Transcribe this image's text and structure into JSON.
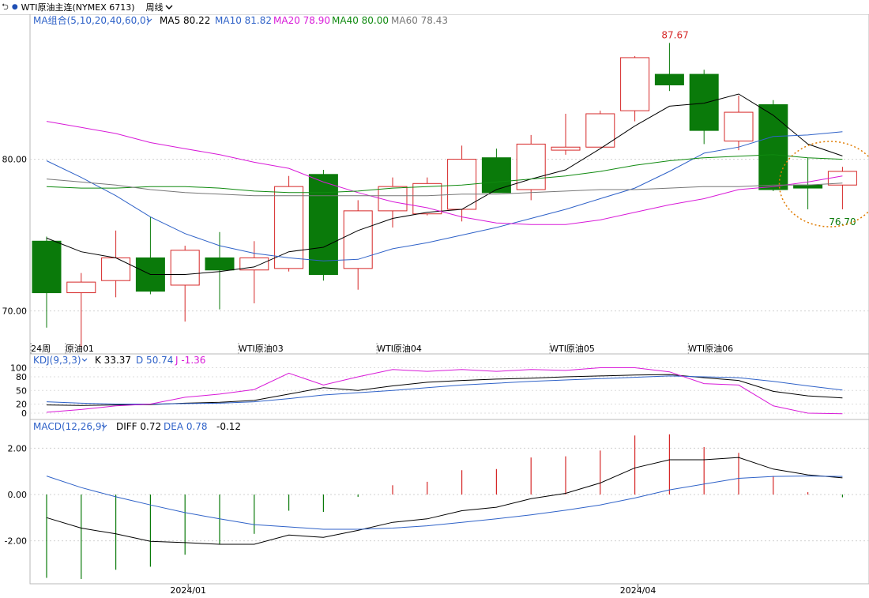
{
  "header": {
    "instrument": "WTI原油主连(NYMEX 6713)",
    "period": "周线"
  },
  "colors": {
    "up": "#d62828",
    "down": "#0a7a0a",
    "ma5": "#000000",
    "ma10": "#2f62c8",
    "ma20": "#d81ad8",
    "ma40": "#108a10",
    "ma60": "#777777",
    "dif": "#000000",
    "dea": "#2f62c8",
    "annotation": "#e07b00"
  },
  "legends": {
    "ma": {
      "name": "MA组合(5,10,20,40,60,0)",
      "ma5": "MA5 80.22",
      "ma10": "MA10 81.82",
      "ma20": "MA20 78.90",
      "ma40": "MA40 80.00",
      "ma60": "MA60 78.43"
    },
    "kdj": {
      "name": "KDJ(9,3,3)",
      "k": "K 33.37",
      "d": "D 50.74",
      "j": "J -1.36"
    },
    "macd": {
      "name": "MACD(12,26,9)",
      "diff": "DIFF 0.72",
      "dea": "DEA 0.78",
      "macd": "-0.12"
    }
  },
  "chart_data": [
    {
      "type": "candlestick",
      "title": "WTI原油主连(NYMEX 6713) 周线",
      "ylim": [
        67,
        88.7
      ],
      "yticks": [
        70,
        80
      ],
      "ytick_labels": [
        "70.00",
        "80.00"
      ],
      "x_labels": [
        {
          "index": 0,
          "text": "24周"
        },
        {
          "index": 1,
          "text": "原油01"
        },
        {
          "index": 6,
          "text": "WTI原油03"
        },
        {
          "index": 10,
          "text": "WTI原油04"
        },
        {
          "index": 15,
          "text": "WTI原油05"
        },
        {
          "index": 19,
          "text": "WTI原油06"
        }
      ],
      "candles": [
        {
          "o": 74.6,
          "h": 74.9,
          "l": 68.9,
          "c": 71.2
        },
        {
          "o": 71.2,
          "h": 72.5,
          "l": 67.6,
          "c": 71.9
        },
        {
          "o": 72.0,
          "h": 75.3,
          "l": 70.9,
          "c": 73.5
        },
        {
          "o": 73.5,
          "h": 76.2,
          "l": 71.1,
          "c": 71.3
        },
        {
          "o": 71.7,
          "h": 74.3,
          "l": 69.3,
          "c": 74.0
        },
        {
          "o": 73.5,
          "h": 75.2,
          "l": 70.1,
          "c": 72.7
        },
        {
          "o": 72.7,
          "h": 74.6,
          "l": 70.5,
          "c": 73.5
        },
        {
          "o": 72.8,
          "h": 78.9,
          "l": 72.6,
          "c": 78.2
        },
        {
          "o": 79.0,
          "h": 79.3,
          "l": 72.0,
          "c": 72.4
        },
        {
          "o": 72.8,
          "h": 77.3,
          "l": 71.4,
          "c": 76.6
        },
        {
          "o": 76.6,
          "h": 78.8,
          "l": 75.5,
          "c": 78.2
        },
        {
          "o": 76.4,
          "h": 78.8,
          "l": 76.3,
          "c": 78.4
        },
        {
          "o": 76.7,
          "h": 80.9,
          "l": 75.9,
          "c": 80.0
        },
        {
          "o": 80.1,
          "h": 80.7,
          "l": 77.9,
          "c": 77.8
        },
        {
          "o": 78.0,
          "h": 81.6,
          "l": 77.3,
          "c": 81.0
        },
        {
          "o": 80.6,
          "h": 83.0,
          "l": 80.3,
          "c": 80.8
        },
        {
          "o": 80.8,
          "h": 83.2,
          "l": 80.9,
          "c": 83.0
        },
        {
          "o": 83.2,
          "h": 86.8,
          "l": 82.5,
          "c": 86.7
        },
        {
          "o": 85.6,
          "h": 87.67,
          "l": 84.5,
          "c": 84.9
        },
        {
          "o": 85.6,
          "h": 85.9,
          "l": 81.0,
          "c": 81.9
        },
        {
          "o": 81.2,
          "h": 84.2,
          "l": 80.6,
          "c": 83.1
        },
        {
          "o": 83.6,
          "h": 83.9,
          "l": 77.9,
          "c": 78.0
        },
        {
          "o": 78.3,
          "h": 80.1,
          "l": 76.7,
          "c": 78.1
        },
        {
          "o": 78.3,
          "h": 79.5,
          "l": 76.7,
          "c": 79.2
        }
      ],
      "annotations": [
        {
          "index": 18,
          "text": "87.67",
          "kind": "high"
        },
        {
          "index": 23,
          "text": "76.70",
          "kind": "low"
        }
      ],
      "highlight_circle_around_indexes": [
        22,
        23
      ],
      "series": [
        {
          "name": "MA5",
          "values": [
            74.8,
            73.9,
            73.5,
            72.4,
            72.4,
            72.6,
            72.9,
            73.9,
            74.2,
            75.3,
            76.1,
            76.5,
            76.7,
            78.0,
            78.7,
            79.3,
            80.7,
            82.2,
            83.5,
            83.7,
            84.3,
            82.9,
            81.0,
            80.22
          ]
        },
        {
          "name": "MA10",
          "values": [
            79.9,
            78.8,
            77.6,
            76.2,
            75.1,
            74.3,
            73.8,
            73.5,
            73.3,
            73.4,
            74.1,
            74.5,
            75.0,
            75.5,
            76.1,
            76.7,
            77.4,
            78.1,
            79.2,
            80.4,
            80.8,
            81.5,
            81.6,
            81.82
          ]
        },
        {
          "name": "MA20",
          "values": [
            82.5,
            82.1,
            81.7,
            81.1,
            80.7,
            80.3,
            79.8,
            79.4,
            78.5,
            77.8,
            77.2,
            76.8,
            76.2,
            75.8,
            75.7,
            75.7,
            76.0,
            76.5,
            77.0,
            77.4,
            78.0,
            78.2,
            78.5,
            78.9
          ]
        },
        {
          "name": "MA40",
          "values": [
            78.2,
            78.1,
            78.1,
            78.2,
            78.2,
            78.1,
            77.9,
            77.8,
            77.8,
            77.9,
            78.1,
            78.2,
            78.3,
            78.5,
            78.7,
            78.9,
            79.2,
            79.6,
            79.9,
            80.1,
            80.2,
            80.3,
            80.1,
            80.0
          ]
        },
        {
          "name": "MA60",
          "values": [
            78.7,
            78.5,
            78.3,
            78.0,
            77.8,
            77.7,
            77.6,
            77.6,
            77.6,
            77.6,
            77.6,
            77.6,
            77.7,
            77.7,
            77.8,
            77.9,
            78.0,
            78.0,
            78.1,
            78.2,
            78.2,
            78.3,
            78.3,
            78.43
          ]
        }
      ]
    },
    {
      "type": "line",
      "title": "KDJ(9,3,3)",
      "ylim": [
        -4,
        108
      ],
      "yticks": [
        0,
        20,
        50,
        80,
        100
      ],
      "ytick_labels": [
        "0",
        "20",
        "50",
        "80",
        "100"
      ],
      "series": [
        {
          "name": "K",
          "values": [
            18,
            17,
            18,
            19,
            22,
            24,
            28,
            42,
            56,
            50,
            60,
            68,
            72,
            75,
            77,
            80,
            82,
            84,
            85,
            78,
            72,
            48,
            38,
            33.37
          ]
        },
        {
          "name": "D",
          "values": [
            25,
            22,
            20,
            20,
            21,
            22,
            25,
            32,
            40,
            45,
            50,
            56,
            62,
            66,
            70,
            73,
            76,
            79,
            82,
            80,
            78,
            70,
            60,
            50.74
          ]
        },
        {
          "name": "J",
          "values": [
            2,
            8,
            16,
            20,
            35,
            42,
            52,
            88,
            62,
            80,
            96,
            92,
            96,
            92,
            96,
            94,
            100,
            100,
            91,
            65,
            62,
            16,
            0,
            -1.36
          ]
        }
      ]
    },
    {
      "type": "bar-line",
      "title": "MACD(12,26,9)",
      "ylim": [
        -3.8,
        2.7
      ],
      "yticks": [
        -2,
        0,
        2
      ],
      "ytick_labels": [
        "-2.00",
        "0.00",
        "2.00"
      ],
      "series": [
        {
          "name": "DIFF",
          "values": [
            -1.0,
            -1.45,
            -1.7,
            -2.02,
            -2.08,
            -2.15,
            -2.15,
            -1.75,
            -1.85,
            -1.55,
            -1.2,
            -1.05,
            -0.7,
            -0.55,
            -0.18,
            0.05,
            0.5,
            1.15,
            1.5,
            1.5,
            1.6,
            1.1,
            0.85,
            0.72
          ]
        },
        {
          "name": "DEA",
          "values": [
            0.8,
            0.3,
            -0.1,
            -0.45,
            -0.78,
            -1.05,
            -1.3,
            -1.4,
            -1.5,
            -1.5,
            -1.45,
            -1.35,
            -1.2,
            -1.05,
            -0.88,
            -0.68,
            -0.45,
            -0.15,
            0.2,
            0.45,
            0.7,
            0.78,
            0.8,
            0.78
          ]
        },
        {
          "name": "MACD",
          "values": [
            -3.6,
            -3.65,
            -3.25,
            -3.12,
            -2.6,
            -2.15,
            -1.7,
            -0.7,
            -0.75,
            -0.1,
            0.4,
            0.55,
            1.05,
            1.1,
            1.6,
            1.65,
            1.9,
            2.55,
            2.6,
            2.05,
            1.8,
            0.8,
            0.1,
            -0.12
          ]
        }
      ]
    }
  ],
  "bottom_axis": {
    "labels": [
      {
        "index": 4,
        "text": "2024/01"
      },
      {
        "index": 17,
        "text": "2024/04"
      }
    ]
  }
}
